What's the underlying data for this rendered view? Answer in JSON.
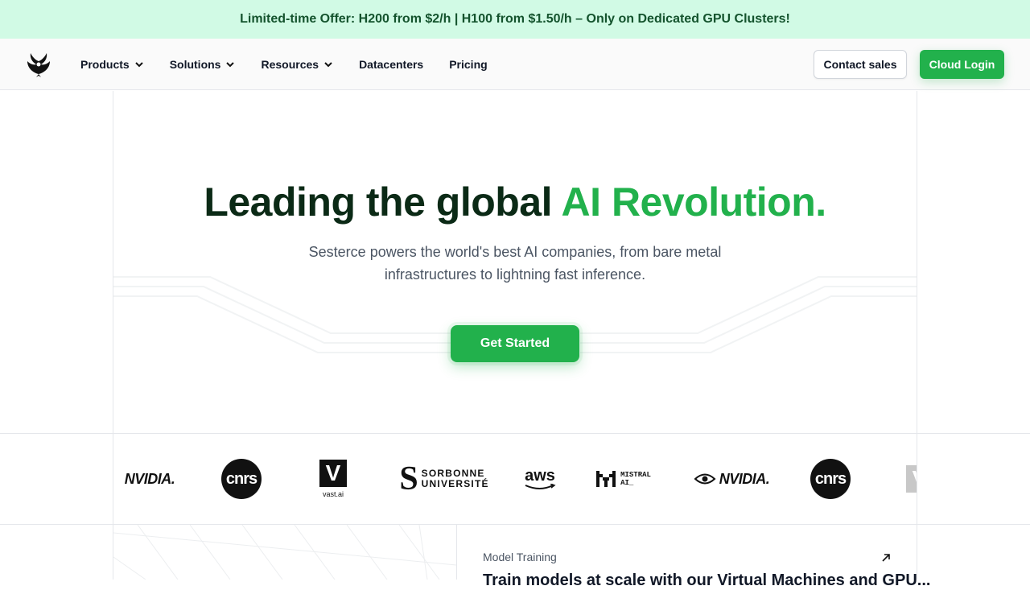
{
  "banner": {
    "text": "Limited-time Offer: H200 from $2/h | H100 from $1.50/h – Only on Dedicated GPU Clusters!"
  },
  "nav": {
    "items": [
      {
        "label": "Products",
        "has_dropdown": true
      },
      {
        "label": "Solutions",
        "has_dropdown": true
      },
      {
        "label": "Resources",
        "has_dropdown": true
      },
      {
        "label": "Datacenters",
        "has_dropdown": false
      },
      {
        "label": "Pricing",
        "has_dropdown": false
      }
    ],
    "contact_label": "Contact sales",
    "login_label": "Cloud Login"
  },
  "hero": {
    "title_main": "Leading the global ",
    "title_accent": "AI Revolution.",
    "subtitle": "Sesterce powers the world's best AI companies, from bare metal infrastructures to lightning fast inference.",
    "cta_label": "Get Started"
  },
  "partners": {
    "nvidia": "NVIDIA.",
    "cnrs": "cnrs",
    "vast_letter": "V",
    "vast_name": "vast.ai",
    "sorbonne_line1": "SORBONNE",
    "sorbonne_line2": "UNIVERSITÉ",
    "aws": "aws",
    "mistral_line1": "MISTRAL",
    "mistral_line2": "AI_"
  },
  "card": {
    "label": "Model Training",
    "title": "Train models at scale with our Virtual Machines and GPU..."
  },
  "colors": {
    "accent": "#22b14c",
    "banner_bg": "#d1fae5",
    "title_dark": "#0b2a16"
  }
}
